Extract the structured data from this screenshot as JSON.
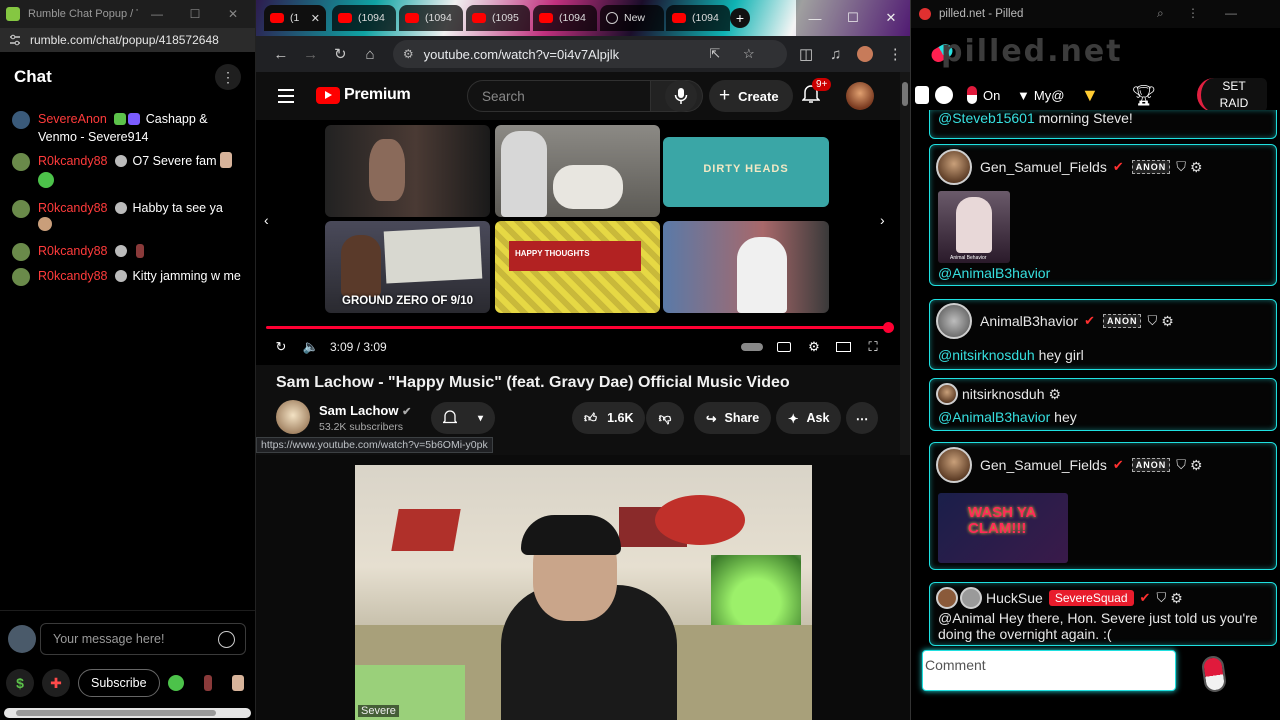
{
  "rumble": {
    "window_title": "Rumble Chat Popup / T...",
    "url": "rumble.com/chat/popup/418572648",
    "chat_title": "Chat",
    "messages": [
      {
        "user": "SevereAnon",
        "user_color": "#ff3b3b",
        "text": "Cashapp & Venmo - Severe914"
      },
      {
        "user": "R0kcandy88",
        "user_color": "#ff3b3b",
        "text": "O7 Severe fam"
      },
      {
        "user": "R0kcandy88",
        "user_color": "#ff3b3b",
        "text": "Habby ta see ya"
      },
      {
        "user": "R0kcandy88",
        "user_color": "#ff3b3b",
        "text": ""
      },
      {
        "user": "R0kcandy88",
        "user_color": "#ff3b3b",
        "text": "Kitty jamming w me"
      }
    ],
    "input_placeholder": "Your message here!",
    "subscribe_label": "Subscribe"
  },
  "chrome": {
    "tabs": [
      "(1",
      "(1094",
      "(1094",
      "(1095",
      "(1094",
      "New",
      "(1094"
    ],
    "url": "youtube.com/watch?v=0i4v7Alpjlk"
  },
  "youtube": {
    "logo_text": "Premium",
    "search_placeholder": "Search",
    "create_label": "Create",
    "notif_count": "9+",
    "end_screen": [
      {
        "caption": ""
      },
      {
        "caption": ""
      },
      {
        "caption": "DIRTY HEADS"
      },
      {
        "caption": "GROUND ZERO OF 9/10"
      },
      {
        "caption": "HAPPY THOUGHTS"
      },
      {
        "caption": ""
      }
    ],
    "progress_fraction": 1.0,
    "time": "3:09 / 3:09",
    "title": "Sam Lachow - \"Happy Music\" (feat. Gravy Dae) Official Music Video",
    "channel": "Sam Lachow",
    "subscribers": "53.2K subscribers",
    "likes": "1.6K",
    "share_label": "Share",
    "ask_label": "Ask",
    "hover_url": "https://www.youtube.com/watch?v=5b6OMi-y0pk"
  },
  "webcam": {
    "label": "Severe"
  },
  "pilled": {
    "window_title": "pilled.net - Pilled",
    "logo": "pilled.net",
    "toolbar": {
      "on_label": "On",
      "my_label": "My@",
      "setraid_label_1": "SET",
      "setraid_label_2": "RAID"
    },
    "messages": [
      {
        "user": "",
        "mention": "@Steveb15601",
        "text": "morning Steve!"
      },
      {
        "user": "Gen_Samuel_Fields",
        "tag": "ANON",
        "mention": "@AnimalB3havior",
        "text": ""
      },
      {
        "user": "AnimalB3havior",
        "tag": "ANON",
        "mention": "@nitsirknosduh",
        "text": "hey girl"
      },
      {
        "user": "nitsirknosduh",
        "tag": "",
        "mention": "@AnimalB3havior",
        "text": "hey"
      },
      {
        "user": "Gen_Samuel_Fields",
        "tag": "ANON",
        "mention": "",
        "text": ""
      },
      {
        "user": "HuckSue",
        "tag": "SevereSquad",
        "mention": "",
        "text": "@Animal Hey there, Hon. Severe just told us you're doing the overnight again. :("
      }
    ],
    "comment_placeholder": "Comment",
    "image_text_1": "Animal Behavior",
    "image_text_2": "WASH YA CLAM!!!"
  }
}
